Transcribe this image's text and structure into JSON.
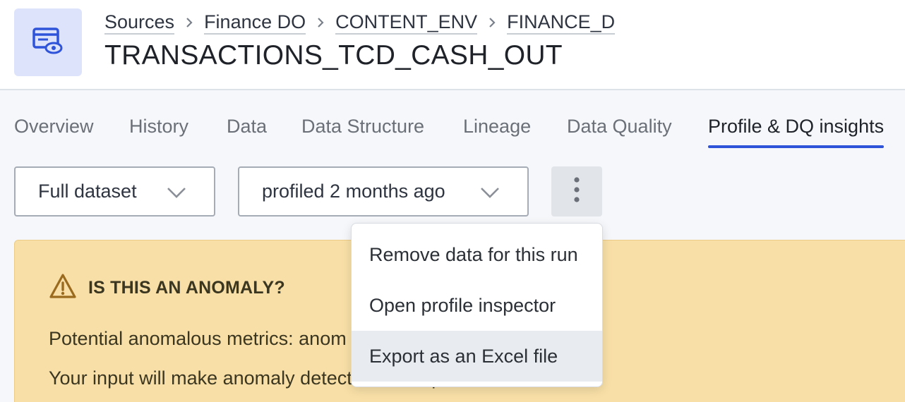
{
  "header": {
    "breadcrumb": [
      "Sources",
      "Finance DO",
      "CONTENT_ENV",
      "FINANCE_D"
    ],
    "title": "TRANSACTIONS_TCD_CASH_OUT",
    "entity_icon": "table-view-icon",
    "accent": "#2f54d9"
  },
  "tabs": [
    {
      "label": "Overview",
      "active": false
    },
    {
      "label": "History",
      "active": false
    },
    {
      "label": "Data",
      "active": false
    },
    {
      "label": "Data Structure",
      "active": false
    },
    {
      "label": "Lineage",
      "active": false
    },
    {
      "label": "Data Quality",
      "active": false
    },
    {
      "label": "Profile & DQ insights",
      "active": true
    }
  ],
  "toolbar": {
    "scope_select": "Full dataset",
    "run_select": "profiled 2 months ago",
    "more_icon": "more-vertical-icon"
  },
  "banner": {
    "title": "IS THIS AN ANOMALY?",
    "line1": "Potential anomalous metrics: anom",
    "line2": "Your input will make anomaly detection more p",
    "icon": "warning-icon",
    "bg_color": "#f8dfa7"
  },
  "menu": {
    "items": [
      "Remove data for this run",
      "Open profile inspector",
      "Export as an Excel file"
    ],
    "hovered_index": 2
  }
}
